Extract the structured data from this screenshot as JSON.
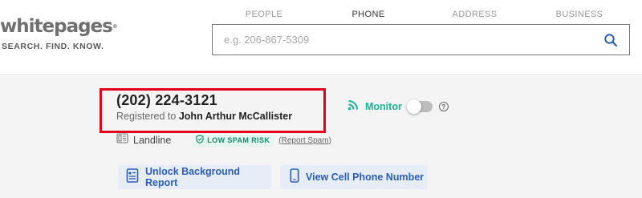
{
  "logo": {
    "brand": "whitepages",
    "tagline": "SEARCH. FIND. KNOW."
  },
  "tabs": [
    {
      "label": "PEOPLE",
      "active": false
    },
    {
      "label": "PHONE",
      "active": true
    },
    {
      "label": "ADDRESS",
      "active": false
    },
    {
      "label": "BUSINESS",
      "active": false
    }
  ],
  "search": {
    "placeholder": "e.g. 206-867-5309",
    "value": "",
    "icon": "search-icon"
  },
  "result": {
    "phone_number": "(202) 224-3121",
    "registered_prefix": "Registered to",
    "registered_name": "John Arthur McCallister",
    "line_type": "Landline",
    "spam_badge": "LOW SPAM RISK",
    "report_spam": "(Report Spam)"
  },
  "monitor": {
    "label": "Monitor",
    "enabled": false,
    "help": "?"
  },
  "actions": {
    "unlock_report": "Unlock Background Report",
    "view_cell": "View Cell Phone Number"
  },
  "colors": {
    "accent_blue": "#2b5cb8",
    "monitor_green": "#1ab394",
    "highlight_red": "#e4001b",
    "spam_green": "#1a8b6a"
  }
}
